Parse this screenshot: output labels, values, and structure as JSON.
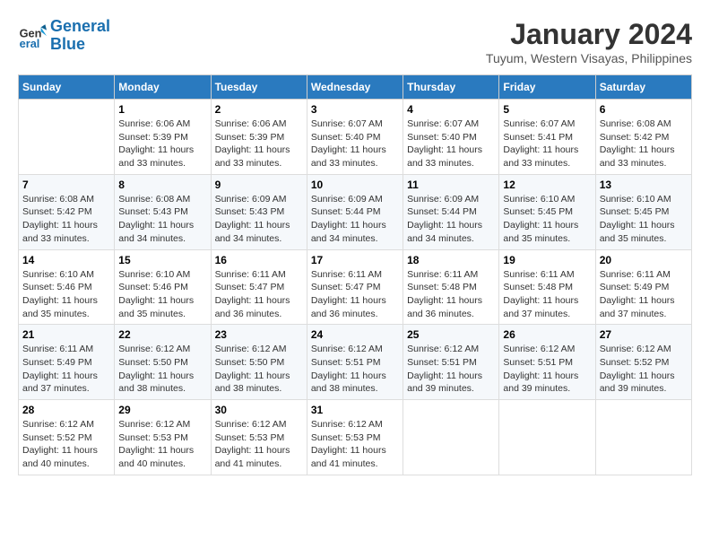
{
  "logo": {
    "line1": "General",
    "line2": "Blue"
  },
  "title": "January 2024",
  "location": "Tuyum, Western Visayas, Philippines",
  "days_of_week": [
    "Sunday",
    "Monday",
    "Tuesday",
    "Wednesday",
    "Thursday",
    "Friday",
    "Saturday"
  ],
  "weeks": [
    [
      {
        "num": "",
        "sunrise": "",
        "sunset": "",
        "daylight": ""
      },
      {
        "num": "1",
        "sunrise": "Sunrise: 6:06 AM",
        "sunset": "Sunset: 5:39 PM",
        "daylight": "Daylight: 11 hours and 33 minutes."
      },
      {
        "num": "2",
        "sunrise": "Sunrise: 6:06 AM",
        "sunset": "Sunset: 5:39 PM",
        "daylight": "Daylight: 11 hours and 33 minutes."
      },
      {
        "num": "3",
        "sunrise": "Sunrise: 6:07 AM",
        "sunset": "Sunset: 5:40 PM",
        "daylight": "Daylight: 11 hours and 33 minutes."
      },
      {
        "num": "4",
        "sunrise": "Sunrise: 6:07 AM",
        "sunset": "Sunset: 5:40 PM",
        "daylight": "Daylight: 11 hours and 33 minutes."
      },
      {
        "num": "5",
        "sunrise": "Sunrise: 6:07 AM",
        "sunset": "Sunset: 5:41 PM",
        "daylight": "Daylight: 11 hours and 33 minutes."
      },
      {
        "num": "6",
        "sunrise": "Sunrise: 6:08 AM",
        "sunset": "Sunset: 5:42 PM",
        "daylight": "Daylight: 11 hours and 33 minutes."
      }
    ],
    [
      {
        "num": "7",
        "sunrise": "Sunrise: 6:08 AM",
        "sunset": "Sunset: 5:42 PM",
        "daylight": "Daylight: 11 hours and 33 minutes."
      },
      {
        "num": "8",
        "sunrise": "Sunrise: 6:08 AM",
        "sunset": "Sunset: 5:43 PM",
        "daylight": "Daylight: 11 hours and 34 minutes."
      },
      {
        "num": "9",
        "sunrise": "Sunrise: 6:09 AM",
        "sunset": "Sunset: 5:43 PM",
        "daylight": "Daylight: 11 hours and 34 minutes."
      },
      {
        "num": "10",
        "sunrise": "Sunrise: 6:09 AM",
        "sunset": "Sunset: 5:44 PM",
        "daylight": "Daylight: 11 hours and 34 minutes."
      },
      {
        "num": "11",
        "sunrise": "Sunrise: 6:09 AM",
        "sunset": "Sunset: 5:44 PM",
        "daylight": "Daylight: 11 hours and 34 minutes."
      },
      {
        "num": "12",
        "sunrise": "Sunrise: 6:10 AM",
        "sunset": "Sunset: 5:45 PM",
        "daylight": "Daylight: 11 hours and 35 minutes."
      },
      {
        "num": "13",
        "sunrise": "Sunrise: 6:10 AM",
        "sunset": "Sunset: 5:45 PM",
        "daylight": "Daylight: 11 hours and 35 minutes."
      }
    ],
    [
      {
        "num": "14",
        "sunrise": "Sunrise: 6:10 AM",
        "sunset": "Sunset: 5:46 PM",
        "daylight": "Daylight: 11 hours and 35 minutes."
      },
      {
        "num": "15",
        "sunrise": "Sunrise: 6:10 AM",
        "sunset": "Sunset: 5:46 PM",
        "daylight": "Daylight: 11 hours and 35 minutes."
      },
      {
        "num": "16",
        "sunrise": "Sunrise: 6:11 AM",
        "sunset": "Sunset: 5:47 PM",
        "daylight": "Daylight: 11 hours and 36 minutes."
      },
      {
        "num": "17",
        "sunrise": "Sunrise: 6:11 AM",
        "sunset": "Sunset: 5:47 PM",
        "daylight": "Daylight: 11 hours and 36 minutes."
      },
      {
        "num": "18",
        "sunrise": "Sunrise: 6:11 AM",
        "sunset": "Sunset: 5:48 PM",
        "daylight": "Daylight: 11 hours and 36 minutes."
      },
      {
        "num": "19",
        "sunrise": "Sunrise: 6:11 AM",
        "sunset": "Sunset: 5:48 PM",
        "daylight": "Daylight: 11 hours and 37 minutes."
      },
      {
        "num": "20",
        "sunrise": "Sunrise: 6:11 AM",
        "sunset": "Sunset: 5:49 PM",
        "daylight": "Daylight: 11 hours and 37 minutes."
      }
    ],
    [
      {
        "num": "21",
        "sunrise": "Sunrise: 6:11 AM",
        "sunset": "Sunset: 5:49 PM",
        "daylight": "Daylight: 11 hours and 37 minutes."
      },
      {
        "num": "22",
        "sunrise": "Sunrise: 6:12 AM",
        "sunset": "Sunset: 5:50 PM",
        "daylight": "Daylight: 11 hours and 38 minutes."
      },
      {
        "num": "23",
        "sunrise": "Sunrise: 6:12 AM",
        "sunset": "Sunset: 5:50 PM",
        "daylight": "Daylight: 11 hours and 38 minutes."
      },
      {
        "num": "24",
        "sunrise": "Sunrise: 6:12 AM",
        "sunset": "Sunset: 5:51 PM",
        "daylight": "Daylight: 11 hours and 38 minutes."
      },
      {
        "num": "25",
        "sunrise": "Sunrise: 6:12 AM",
        "sunset": "Sunset: 5:51 PM",
        "daylight": "Daylight: 11 hours and 39 minutes."
      },
      {
        "num": "26",
        "sunrise": "Sunrise: 6:12 AM",
        "sunset": "Sunset: 5:51 PM",
        "daylight": "Daylight: 11 hours and 39 minutes."
      },
      {
        "num": "27",
        "sunrise": "Sunrise: 6:12 AM",
        "sunset": "Sunset: 5:52 PM",
        "daylight": "Daylight: 11 hours and 39 minutes."
      }
    ],
    [
      {
        "num": "28",
        "sunrise": "Sunrise: 6:12 AM",
        "sunset": "Sunset: 5:52 PM",
        "daylight": "Daylight: 11 hours and 40 minutes."
      },
      {
        "num": "29",
        "sunrise": "Sunrise: 6:12 AM",
        "sunset": "Sunset: 5:53 PM",
        "daylight": "Daylight: 11 hours and 40 minutes."
      },
      {
        "num": "30",
        "sunrise": "Sunrise: 6:12 AM",
        "sunset": "Sunset: 5:53 PM",
        "daylight": "Daylight: 11 hours and 41 minutes."
      },
      {
        "num": "31",
        "sunrise": "Sunrise: 6:12 AM",
        "sunset": "Sunset: 5:53 PM",
        "daylight": "Daylight: 11 hours and 41 minutes."
      },
      {
        "num": "",
        "sunrise": "",
        "sunset": "",
        "daylight": ""
      },
      {
        "num": "",
        "sunrise": "",
        "sunset": "",
        "daylight": ""
      },
      {
        "num": "",
        "sunrise": "",
        "sunset": "",
        "daylight": ""
      }
    ]
  ]
}
